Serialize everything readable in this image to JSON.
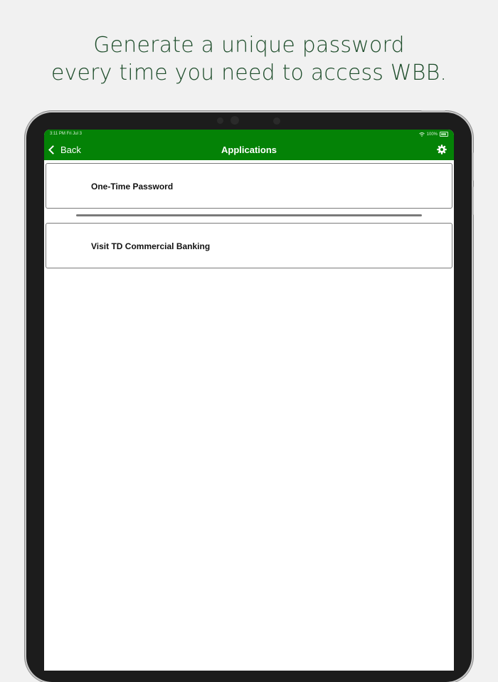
{
  "headline": {
    "line1": "Generate a unique password",
    "line2": "every time you need to access WBB."
  },
  "status_bar": {
    "time": "3:11 PM   Fri Jul 3",
    "battery": "100%",
    "icons": [
      "wifi-icon",
      "battery-icon"
    ]
  },
  "nav": {
    "back_label": "Back",
    "title": "Applications",
    "settings_icon": "gear-icon"
  },
  "colors": {
    "brand_green": "#048206",
    "headline_green": "#1e4d2b"
  },
  "list": [
    {
      "label": "One-Time Password"
    },
    {
      "label": "Visit TD Commercial Banking"
    }
  ]
}
